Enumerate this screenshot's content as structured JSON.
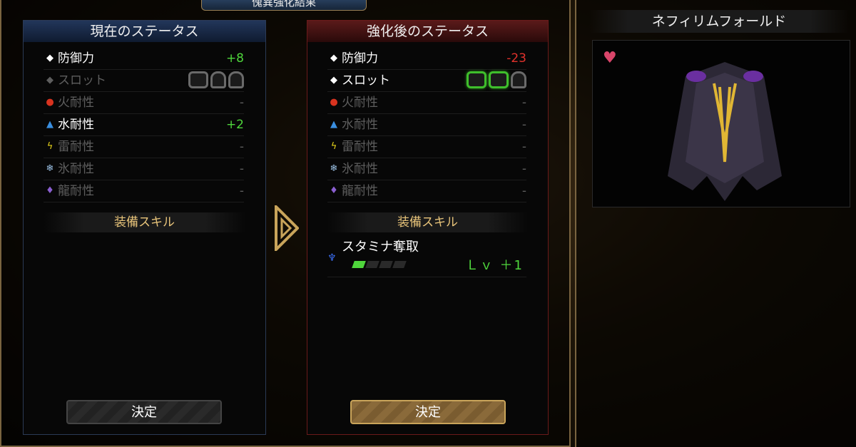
{
  "window": {
    "title": "傀異強化結果"
  },
  "current": {
    "header": "現在のステータス",
    "stats": [
      {
        "icon": "diamond-icon",
        "label": "防御力",
        "value": "+8"
      },
      {
        "icon": "diamond-icon",
        "label": "スロット",
        "value": ""
      },
      {
        "icon": "fire-icon",
        "label": "火耐性",
        "value": "-"
      },
      {
        "icon": "water-icon",
        "label": "水耐性",
        "value": "+2"
      },
      {
        "icon": "thunder-icon",
        "label": "雷耐性",
        "value": "-"
      },
      {
        "icon": "ice-icon",
        "label": "氷耐性",
        "value": "-"
      },
      {
        "icon": "dragon-icon",
        "label": "龍耐性",
        "value": "-"
      }
    ],
    "skills_header": "装備スキル",
    "confirm": "決定"
  },
  "after": {
    "header": "強化後のステータス",
    "stats": [
      {
        "icon": "diamond-icon",
        "label": "防御力",
        "value": "-23"
      },
      {
        "icon": "diamond-icon",
        "label": "スロット",
        "value": ""
      },
      {
        "icon": "fire-icon",
        "label": "火耐性",
        "value": "-"
      },
      {
        "icon": "water-icon",
        "label": "水耐性",
        "value": "-"
      },
      {
        "icon": "thunder-icon",
        "label": "雷耐性",
        "value": "-"
      },
      {
        "icon": "ice-icon",
        "label": "氷耐性",
        "value": "-"
      },
      {
        "icon": "dragon-icon",
        "label": "龍耐性",
        "value": "-"
      }
    ],
    "skills_header": "装備スキル",
    "skills": [
      {
        "name": "スタミナ奪取",
        "level": "Ｌｖ ＋1",
        "bar_filled": 1,
        "bar_total": 4
      }
    ],
    "confirm": "決定"
  },
  "item": {
    "name": "ネフィリムフォールド"
  },
  "colors": {
    "positive": "#4fd63c",
    "negative": "#e2322c",
    "gold": "#e8c47a"
  }
}
